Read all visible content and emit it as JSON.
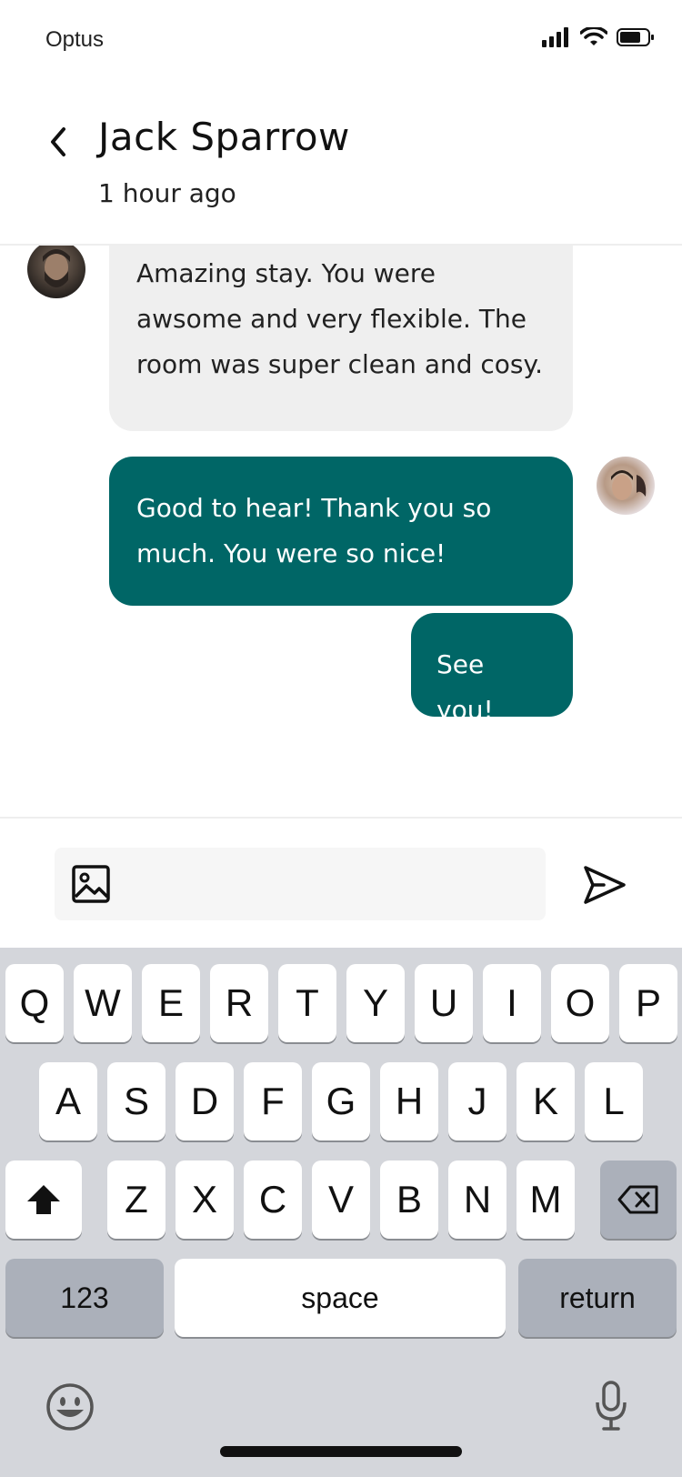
{
  "status_bar": {
    "carrier": "Optus"
  },
  "header": {
    "contact_name": "Jack Sparrow",
    "last_seen": "1 hour ago"
  },
  "messages": [
    {
      "from": "contact",
      "text": "Amazing stay. You were awsome and very flexible. The room was super clean and cosy."
    },
    {
      "from": "me",
      "text": "Good to hear! Thank you so much. You were so nice!"
    },
    {
      "from": "me",
      "text": "See you!"
    }
  ],
  "composer": {
    "placeholder": ""
  },
  "keyboard": {
    "row1": [
      "Q",
      "W",
      "E",
      "R",
      "T",
      "Y",
      "U",
      "I",
      "O",
      "P"
    ],
    "row2": [
      "A",
      "S",
      "D",
      "F",
      "G",
      "H",
      "J",
      "K",
      "L"
    ],
    "row3": [
      "Z",
      "X",
      "C",
      "V",
      "B",
      "N",
      "M"
    ],
    "numbers_label": "123",
    "space_label": "space",
    "return_label": "return"
  },
  "colors": {
    "accent": "#006666",
    "received_bubble": "#efefef",
    "keyboard_bg": "#d4d6db"
  }
}
